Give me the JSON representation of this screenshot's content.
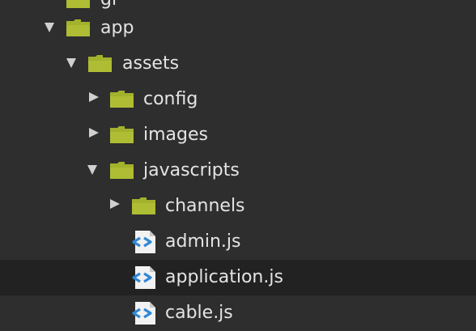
{
  "tree": {
    "items": [
      {
        "label": "gi",
        "type": "folder",
        "expanded": false
      },
      {
        "label": "app",
        "type": "folder",
        "expanded": true
      },
      {
        "label": "assets",
        "type": "folder",
        "expanded": true
      },
      {
        "label": "config",
        "type": "folder",
        "expanded": false
      },
      {
        "label": "images",
        "type": "folder",
        "expanded": false
      },
      {
        "label": "javascripts",
        "type": "folder",
        "expanded": true
      },
      {
        "label": "channels",
        "type": "folder",
        "expanded": false
      },
      {
        "label": "admin.js",
        "type": "file"
      },
      {
        "label": "application.js",
        "type": "file",
        "selected": true
      },
      {
        "label": "cable.js",
        "type": "file"
      }
    ]
  },
  "colors": {
    "background": "#2e2e2e",
    "selected_row": "#222222",
    "folder": "#a3b22c",
    "text": "#e4e4e4",
    "file_icon_accent": "#2f88d6"
  }
}
